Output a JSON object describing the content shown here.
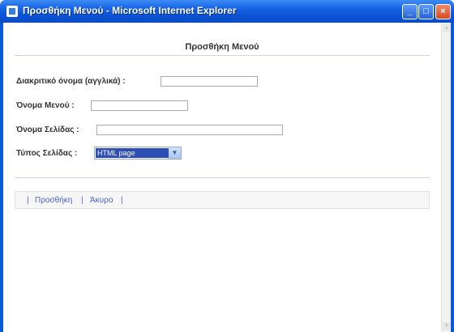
{
  "window": {
    "title": "Προσθήκη Μενού - Microsoft Internet Explorer",
    "minimize": "_",
    "maximize": "□",
    "close": "×"
  },
  "page": {
    "heading": "Προσθήκη Μενού",
    "fields": {
      "internal_name_label": "Διακριτικό όνομα (αγγλικά) :",
      "menu_name_label": "Όνομα Μενού :",
      "page_name_label": "Όνομα Σελίδας :",
      "page_type_label": "Τύπος Σελίδας :",
      "page_type_value": "HTML page"
    },
    "actions": {
      "separator": "|",
      "add_label": "Προσθήκη",
      "cancel_label": "Άκυρο"
    }
  },
  "colors": {
    "titlebar": "#0b52d4",
    "link": "#4a62c0",
    "select_highlight": "#2d4fb3"
  },
  "icons": [
    "ie-page-icon",
    "minimize-icon",
    "maximize-icon",
    "close-icon",
    "chevron-down-icon"
  ]
}
